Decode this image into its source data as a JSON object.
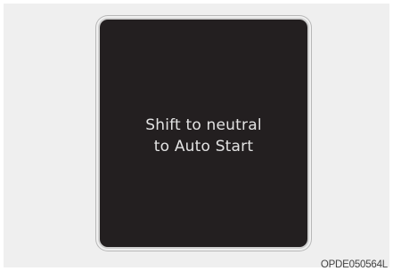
{
  "display": {
    "message_line1": "Shift to neutral",
    "message_line2": "to Auto Start"
  },
  "figure": {
    "code": "OPDE050564L"
  },
  "colors": {
    "frame_background": "#efefef",
    "screen_background": "#231f20",
    "message_text": "#e3e3e3"
  }
}
